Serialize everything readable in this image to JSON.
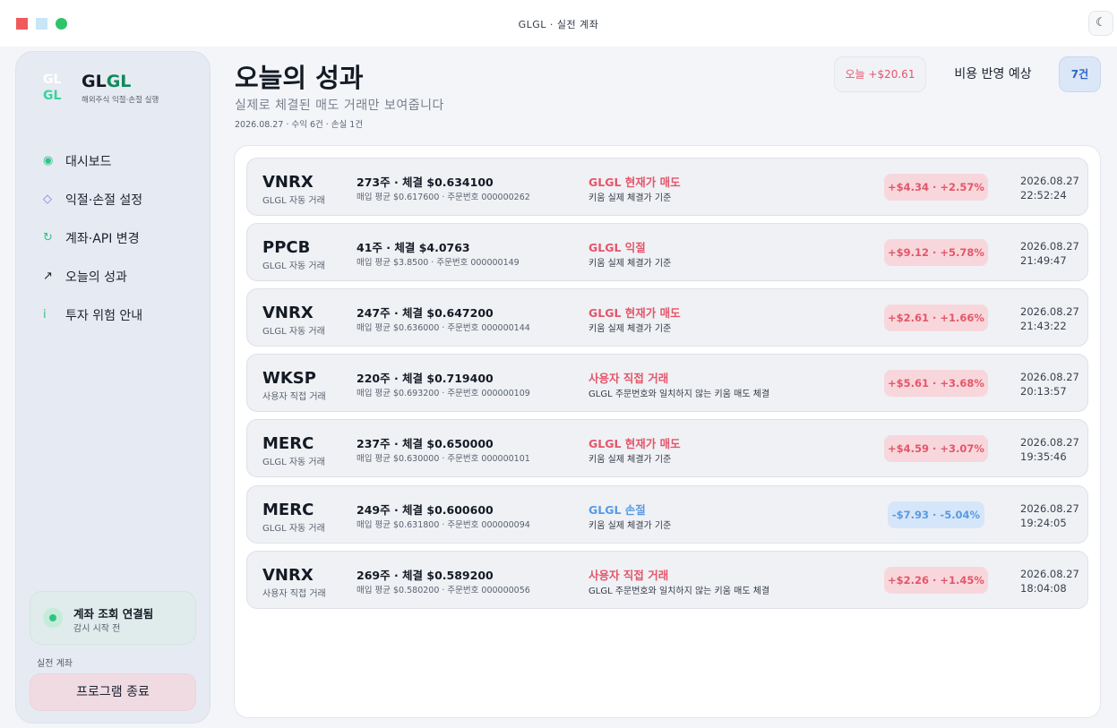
{
  "window": {
    "title": "GLGL · 실전 계좌",
    "theme_icon": "moon-icon",
    "theme_glyph": "☾"
  },
  "sidebar": {
    "logo_mark_line1": "GL",
    "logo_mark_line2": "GL",
    "brand_part1": "GL",
    "brand_part2": "GL",
    "brand_sub": "해외주식 익절·손절 실행",
    "nav": [
      {
        "label": "대시보드",
        "icon": "target-dot-icon",
        "glyph": "◉"
      },
      {
        "label": "익절·손절 설정",
        "icon": "diamond-icon",
        "glyph": "◇"
      },
      {
        "label": "계좌·API 변경",
        "icon": "refresh-icon",
        "glyph": "↻"
      },
      {
        "label": "오늘의 성과",
        "icon": "trend-arrow-icon",
        "glyph": "↗"
      },
      {
        "label": "투자 위험 안내",
        "icon": "info-icon",
        "glyph": "i"
      }
    ],
    "status_title": "계좌 조회 연결됨",
    "status_sub": "감시 시작 전",
    "account_label": "실전 계좌",
    "quit_label": "프로그램 종료"
  },
  "header": {
    "title": "오늘의 성과",
    "subtitle": "실제로 체결된 매도 거래만 보여줍니다",
    "meta": "2026.08.27 · 수익 6건 · 손실 1건",
    "today_chip": "오늘 +$20.61",
    "fee_chip": "비용 반영 예상",
    "count_chip": "7건"
  },
  "trades": [
    {
      "symbol": "VNRX",
      "source": "GLGL 자동 거래",
      "qty": "273주 · 체결 $0.634100",
      "avg": "매입 평균 $0.617600 · 주문번호 000000262",
      "reason": "GLGL 현재가 매도",
      "basis": "키움 실제 체결가 기준",
      "pnl": "+$4.34 · +2.57%",
      "date": "2026.08.27",
      "time": "22:52:24"
    },
    {
      "symbol": "PPCB",
      "source": "GLGL 자동 거래",
      "qty": "41주 · 체결 $4.0763",
      "avg": "매입 평균 $3.8500 · 주문번호 000000149",
      "reason": "GLGL 익절",
      "basis": "키움 실제 체결가 기준",
      "pnl": "+$9.12 · +5.78%",
      "date": "2026.08.27",
      "time": "21:49:47"
    },
    {
      "symbol": "VNRX",
      "source": "GLGL 자동 거래",
      "qty": "247주 · 체결 $0.647200",
      "avg": "매입 평균 $0.636000 · 주문번호 000000144",
      "reason": "GLGL 현재가 매도",
      "basis": "키움 실제 체결가 기준",
      "pnl": "+$2.61 · +1.66%",
      "date": "2026.08.27",
      "time": "21:43:22"
    },
    {
      "symbol": "WKSP",
      "source": "사용자 직접 거래",
      "qty": "220주 · 체결 $0.719400",
      "avg": "매입 평균 $0.693200 · 주문번호 000000109",
      "reason": "사용자 직접 거래",
      "basis": "GLGL 주문번호와 일치하지 않는 키움 매도 체결",
      "pnl": "+$5.61 · +3.68%",
      "date": "2026.08.27",
      "time": "20:13:57"
    },
    {
      "symbol": "MERC",
      "source": "GLGL 자동 거래",
      "qty": "237주 · 체결 $0.650000",
      "avg": "매입 평균 $0.630000 · 주문번호 000000101",
      "reason": "GLGL 현재가 매도",
      "basis": "키움 실제 체결가 기준",
      "pnl": "+$4.59 · +3.07%",
      "date": "2026.08.27",
      "time": "19:35:46"
    },
    {
      "symbol": "MERC",
      "source": "GLGL 자동 거래",
      "qty": "249주 · 체결 $0.600600",
      "avg": "매입 평균 $0.631800 · 주문번호 000000094",
      "reason": "GLGL 손절",
      "basis": "키움 실제 체결가 기준",
      "pnl": "-$7.93 · -5.04%",
      "date": "2026.08.27",
      "time": "19:24:05"
    },
    {
      "symbol": "VNRX",
      "source": "사용자 직접 거래",
      "qty": "269주 · 체결 $0.589200",
      "avg": "매입 평균 $0.580200 · 주문번호 000000056",
      "reason": "사용자 직접 거래",
      "basis": "GLGL 주문번호와 일치하지 않는 키움 매도 체결",
      "pnl": "+$2.26 · +1.45%",
      "date": "2026.08.27",
      "time": "18:04:08"
    }
  ],
  "colors": {
    "profit": "#e4566a",
    "loss": "#5a9be0",
    "accent": "#2fc486"
  }
}
